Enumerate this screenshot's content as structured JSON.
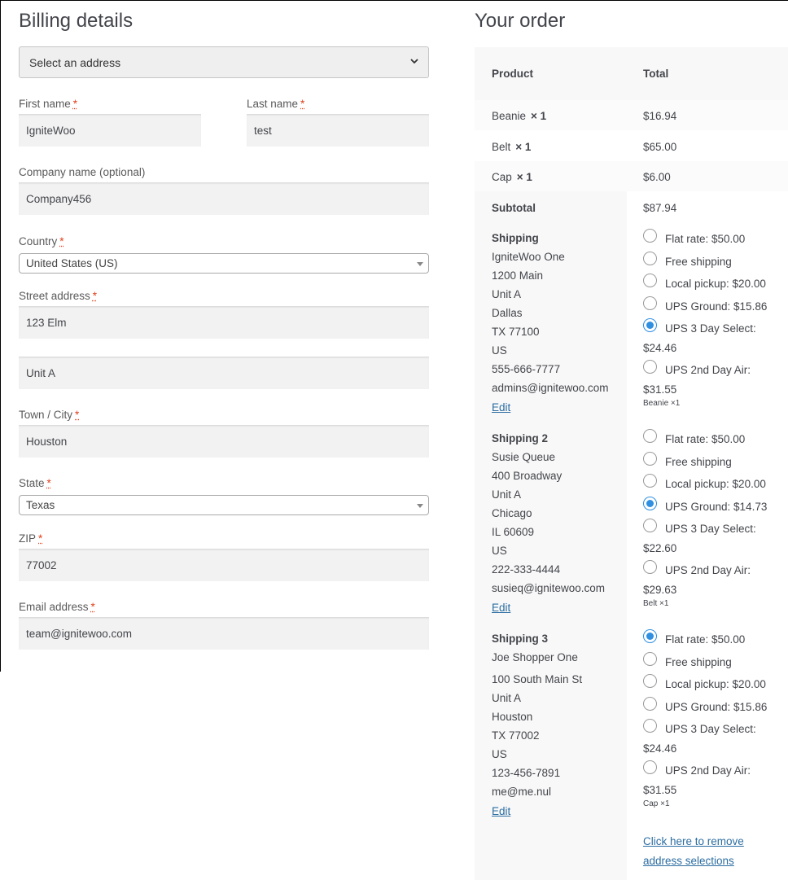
{
  "billing": {
    "title": "Billing details",
    "address_select": "Select an address",
    "first_name": {
      "label": "First name",
      "value": "IgniteWoo"
    },
    "last_name": {
      "label": "Last name",
      "value": "test"
    },
    "company": {
      "label": "Company name (optional)",
      "value": "Company456"
    },
    "country": {
      "label": "Country",
      "value": "United States (US)"
    },
    "street": {
      "label": "Street address",
      "value": "123 Elm",
      "value2": "Unit A"
    },
    "city": {
      "label": "Town / City",
      "value": "Houston"
    },
    "state": {
      "label": "State",
      "value": "Texas"
    },
    "zip": {
      "label": "ZIP",
      "value": "77002"
    },
    "email": {
      "label": "Email address",
      "value": "team@ignitewoo.com"
    },
    "required_mark": "*"
  },
  "order": {
    "title": "Your order",
    "headers": {
      "product": "Product",
      "total": "Total"
    },
    "items": [
      {
        "name": "Beanie",
        "qty": "× 1",
        "total": "$16.94"
      },
      {
        "name": "Belt",
        "qty": "× 1",
        "total": "$65.00"
      },
      {
        "name": "Cap",
        "qty": "× 1",
        "total": "$6.00"
      }
    ],
    "subtotal": {
      "label": "Subtotal",
      "value": "$87.94"
    },
    "shipments": [
      {
        "title": "Shipping",
        "address": [
          "IgniteWoo One",
          "1200 Main",
          "Unit A",
          "Dallas",
          "TX 77100",
          "US",
          "555-666-7777",
          "admins@ignitewoo.com"
        ],
        "edit": "Edit",
        "options": [
          "Flat rate: $50.00",
          "Free shipping",
          "Local pickup: $20.00",
          "UPS Ground: $15.86",
          "UPS 3 Day Select:",
          "UPS 2nd Day Air:"
        ],
        "option_extra": {
          "4": "$24.46",
          "5": "$31.55"
        },
        "selected": 4,
        "note": "Beanie ×1"
      },
      {
        "title": "Shipping 2",
        "address": [
          "Susie Queue",
          "400 Broadway",
          "Unit A",
          "Chicago",
          "IL 60609",
          "US",
          "222-333-4444",
          "susieq@ignitewoo.com"
        ],
        "edit": "Edit",
        "options": [
          "Flat rate: $50.00",
          "Free shipping",
          "Local pickup: $20.00",
          "UPS Ground: $14.73",
          "UPS 3 Day Select:",
          "UPS 2nd Day Air:"
        ],
        "option_extra": {
          "4": "$22.60",
          "5": "$29.63"
        },
        "selected": 3,
        "note": "Belt ×1"
      },
      {
        "title": "Shipping 3",
        "address": [
          "Joe Shopper One",
          "100 South Main St",
          "Unit A",
          "Houston",
          "TX 77002",
          "US",
          "123-456-7891",
          "me@me.nul"
        ],
        "edit": "Edit",
        "options": [
          "Flat rate: $50.00",
          "Free shipping",
          "Local pickup: $20.00",
          "UPS Ground: $15.86",
          "UPS 3 Day Select:",
          "UPS 2nd Day Air:"
        ],
        "option_extra": {
          "4": "$24.46",
          "5": "$31.55"
        },
        "selected": 0,
        "note": "Cap ×1"
      }
    ],
    "remove_link": {
      "line1": "Click here to remove",
      "line2": "address selections"
    },
    "accent": "#2f8fe0",
    "link_color": "#2c6da1",
    "required_color": "#e2401c"
  }
}
